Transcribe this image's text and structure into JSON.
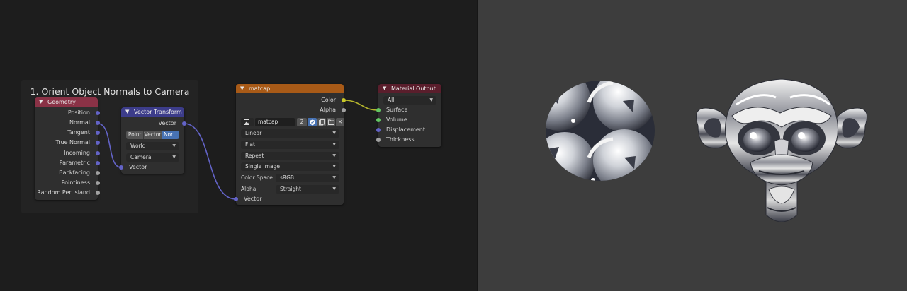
{
  "frame": {
    "title": "1. Orient Object Normals to Camera"
  },
  "geometry": {
    "title": "Geometry",
    "outputs": [
      "Position",
      "Normal",
      "Tangent",
      "True Normal",
      "Incoming",
      "Parametric",
      "Backfacing",
      "Pointiness",
      "Random Per Island"
    ]
  },
  "vector_transform": {
    "title": "Vector Transform",
    "output": "Vector",
    "modes": [
      "Point",
      "Vector",
      "Nor..."
    ],
    "from": "World",
    "to": "Camera",
    "input": "Vector"
  },
  "matcap": {
    "title": "matcap",
    "outputs": [
      "Color",
      "Alpha"
    ],
    "image_name": "matcap",
    "users": "2",
    "interpolation": "Linear",
    "projection": "Flat",
    "extension": "Repeat",
    "source": "Single Image",
    "color_space_label": "Color Space",
    "color_space": "sRGB",
    "alpha_label": "Alpha",
    "alpha": "Straight",
    "input": "Vector"
  },
  "material_output": {
    "title": "Material Output",
    "target": "All",
    "inputs": [
      "Surface",
      "Volume",
      "Displacement",
      "Thickness"
    ]
  },
  "colors": {
    "geometry_header": "#8a3246",
    "vector_header": "#3c3c8a",
    "texture_header": "#a85a17",
    "output_header": "#5a1e2c",
    "viewport_bg": "#3d3d3d"
  }
}
